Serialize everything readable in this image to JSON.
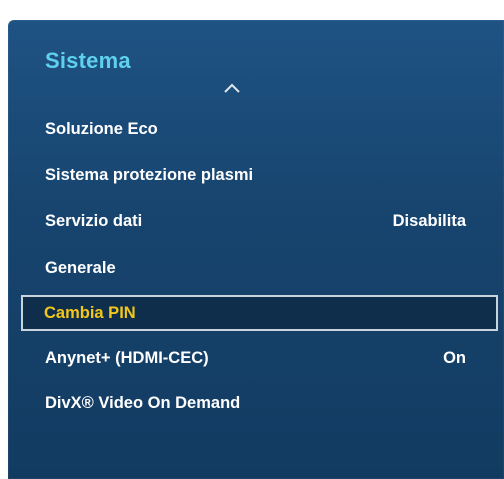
{
  "menu": {
    "title": "Sistema",
    "scroll_up_icon": "chevron-up-icon",
    "items": [
      {
        "label": "Soluzione Eco",
        "value": ""
      },
      {
        "label": "Sistema protezione plasmi",
        "value": ""
      },
      {
        "label": "Servizio dati",
        "value": "Disabilita"
      },
      {
        "label": "Generale",
        "value": ""
      },
      {
        "label": "Cambia PIN",
        "value": "",
        "selected": true
      },
      {
        "label": "Anynet+ (HDMI-CEC)",
        "value": "On"
      },
      {
        "label": "DivX® Video On Demand",
        "value": ""
      }
    ]
  },
  "colors": {
    "panel": "#17456f",
    "title": "#5fd0ee",
    "selected_text": "#f3c619",
    "selected_bg": "#0e2e4b",
    "text": "#ffffff"
  }
}
